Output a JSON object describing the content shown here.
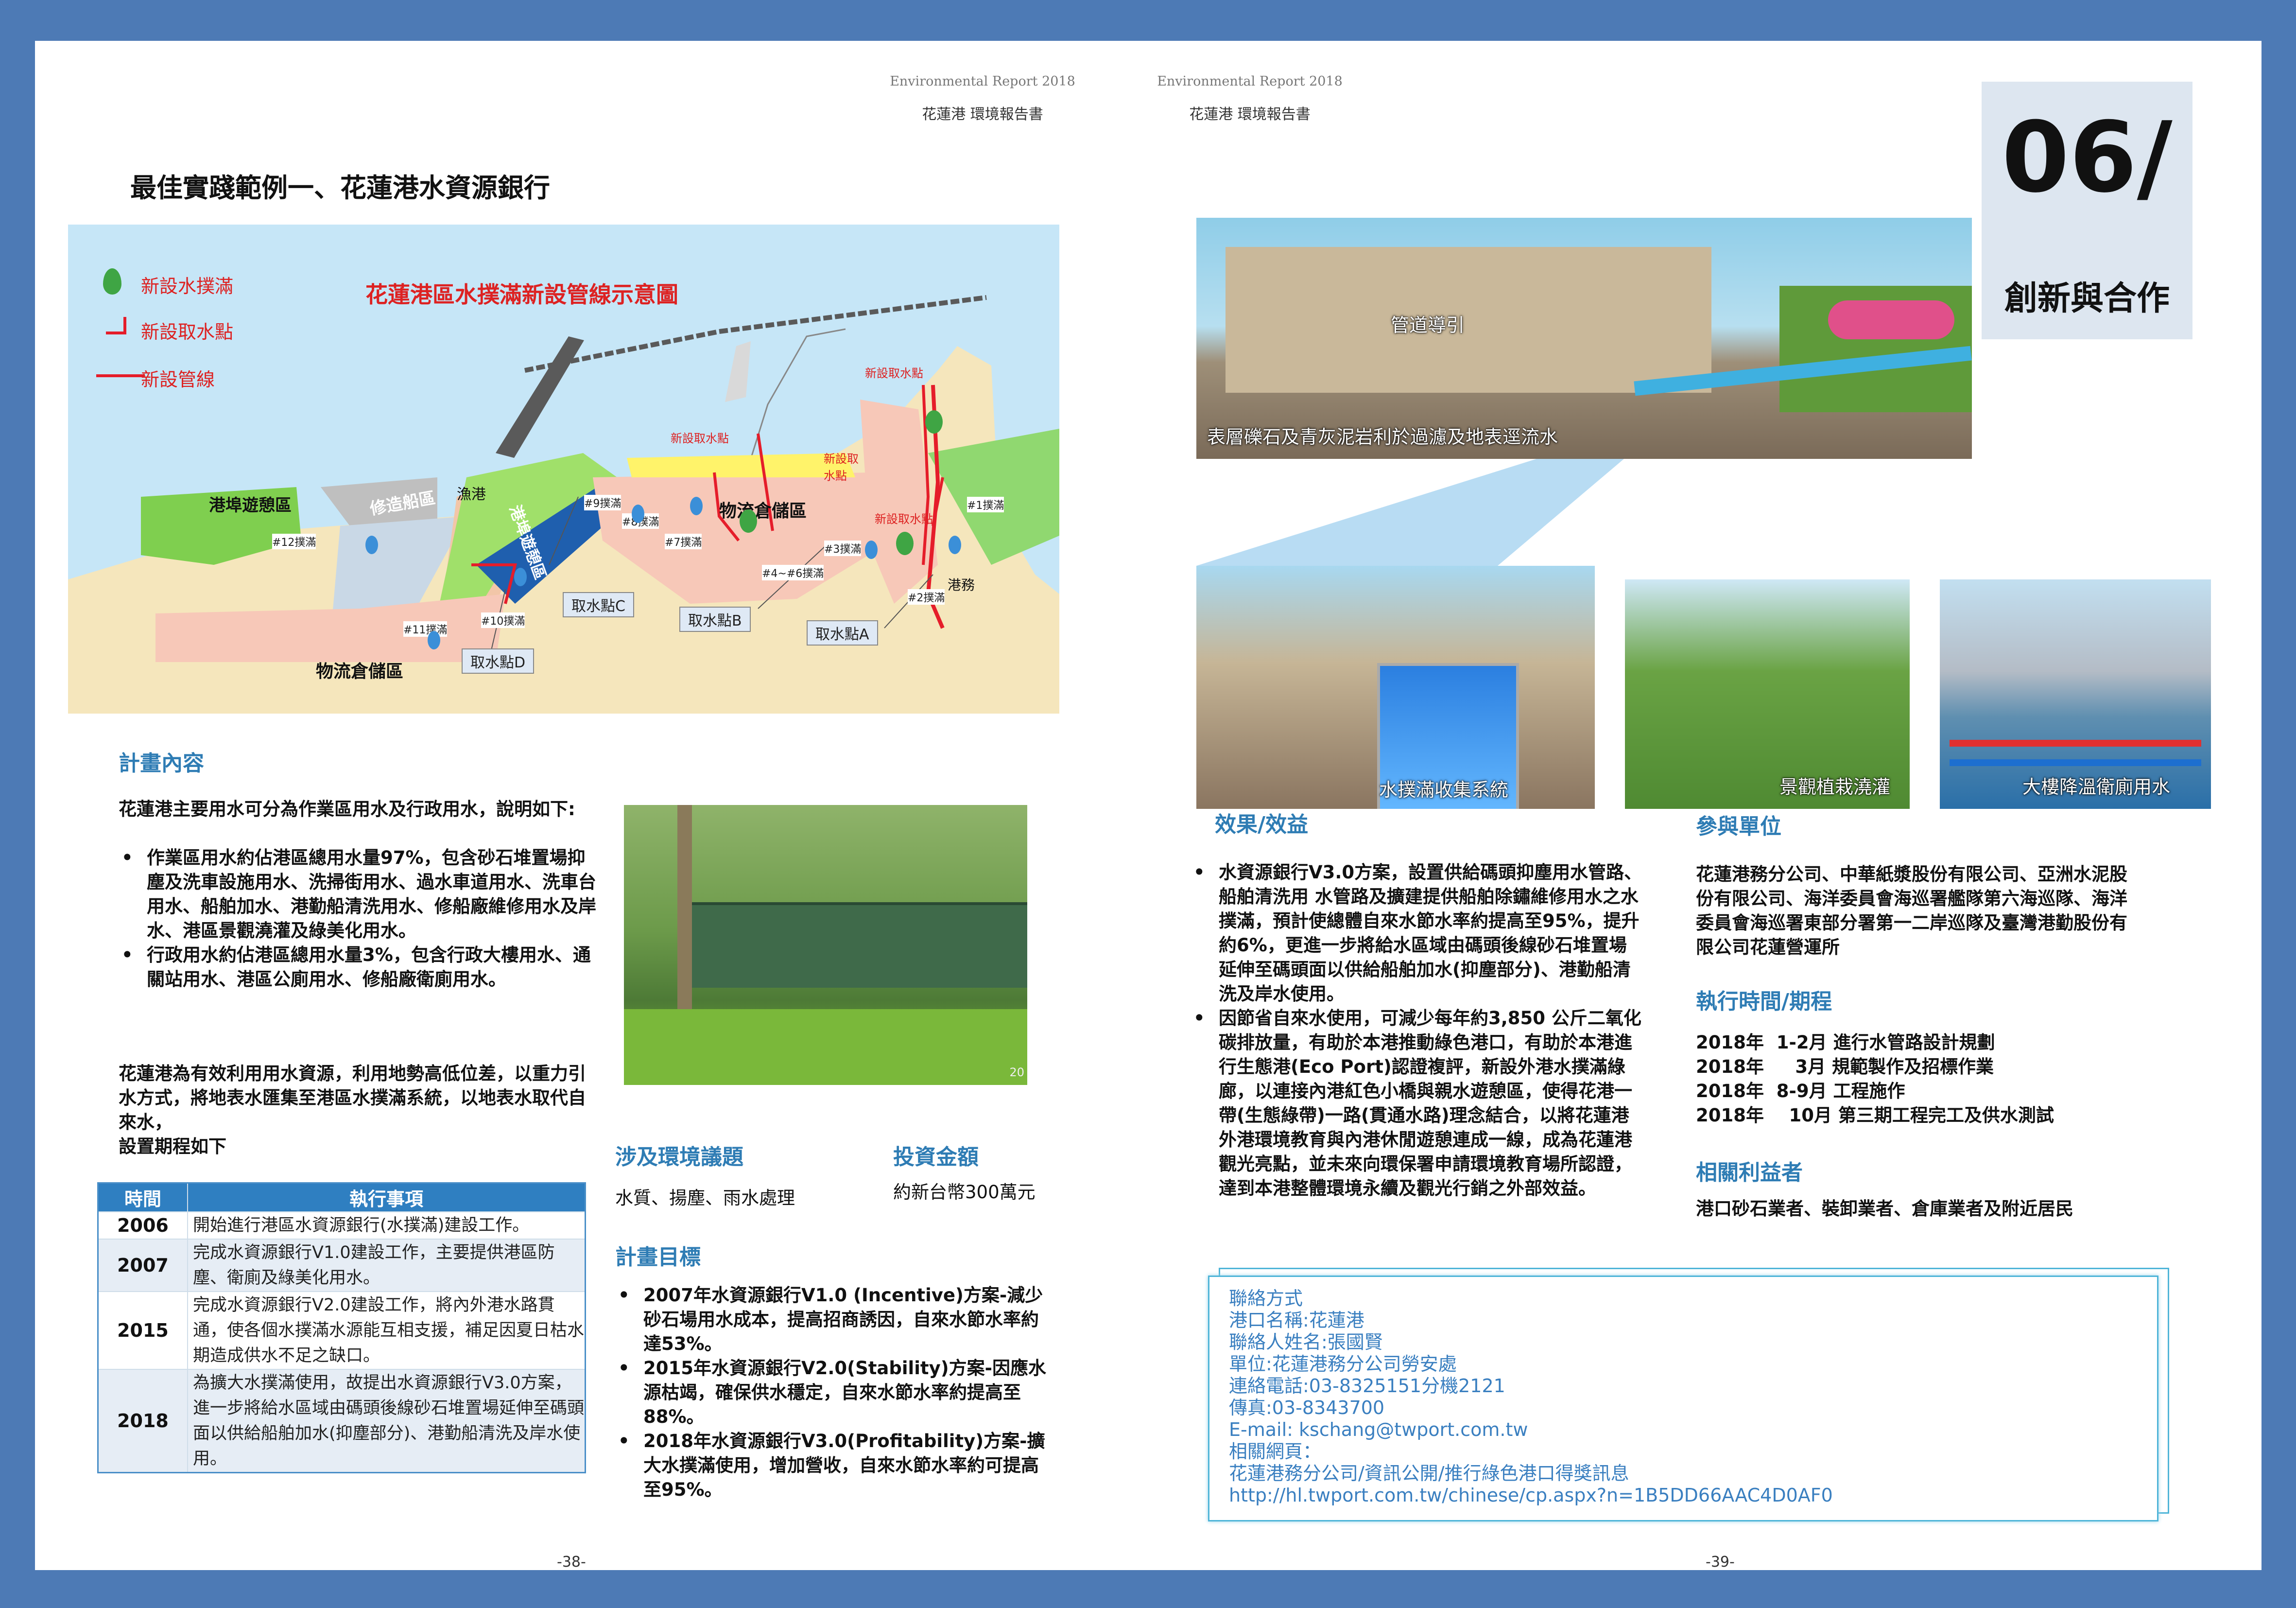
{
  "left_page": {
    "header_en": "Environmental Report 2018",
    "header_zh": "花蓮港 環境報告書",
    "title": "最佳實踐範例一、花蓮港水資源銀行",
    "page_number": "-38-",
    "map": {
      "title": "花蓮港區水撲滿新設管線示意圖",
      "legend": [
        "新設水撲滿",
        "新設取水點",
        "新設管線"
      ],
      "zones": [
        "港埠遊憩區",
        "修造船區",
        "漁港",
        "港埠遊憩區",
        "物流倉儲區",
        "物流倉儲區",
        "港務"
      ],
      "intakes_small": [
        "新設取水點",
        "新設取水點",
        "新設取水點",
        "新設取水點"
      ],
      "boxes": [
        "取水點C",
        "取水點B",
        "取水點A",
        "取水點D"
      ],
      "tanks": [
        "#12撲滿",
        "#11撲滿",
        "#10撲滿",
        "#9撲滿",
        "#8撲滿",
        "#7撲滿",
        "#4~#6撲滿",
        "#3撲滿",
        "#2撲滿",
        "#1撲滿"
      ]
    },
    "plan_content": {
      "heading": "計畫內容",
      "intro": "花蓮港主要用水可分為作業區用水及行政用水，說明如下:",
      "bullets": [
        "作業區用水約佔港區總用水量97%，包含砂石堆置場抑塵及洗車設施用水、洗掃街用水、過水車道用水、洗車台用水、船舶加水、港勤船清洗用水、修船廠維修用水及岸水、港區景觀澆灌及綠美化用水。",
        "行政用水約佔港區總用水量3%，包含行政大樓用水、通關站用水、港區公廁用水、修船廠衛廁用水。"
      ],
      "para2": "花蓮港為有效利用用水資源，利用地勢高低位差，以重力引水方式，將地表水匯集至港區水撲滿系統，以地表水取代自來水，",
      "para3": "設置期程如下"
    },
    "schedule_table": {
      "headers": [
        "時間",
        "執行事項"
      ],
      "rows": [
        {
          "year": "2006",
          "item": "開始進行港區水資源銀行(水撲滿)建設工作。"
        },
        {
          "year": "2007",
          "item": "完成水資源銀行V1.0建設工作，主要提供港區防塵、衛廁及綠美化用水。"
        },
        {
          "year": "2015",
          "item": "完成水資源銀行V2.0建設工作，將內外港水路貫通，使各個水撲滿水源能互相支援，補足因夏日枯水期造成供水不足之缺口。"
        },
        {
          "year": "2018",
          "item": "為擴大水撲滿使用，故提出水資源銀行V3.0方案，進一步將給水區域由碼頭後線砂石堆置場延伸至碼頭面以供給船舶加水(抑塵部分)、港勤船清洗及岸水使用。"
        }
      ]
    },
    "env_issues": {
      "heading": "涉及環境議題",
      "text": "水質、揚塵、雨水處理"
    },
    "investment": {
      "heading": "投資金額",
      "text": "約新台幣300萬元"
    },
    "plan_goals": {
      "heading": "計畫目標",
      "bullets": [
        "2007年水資源銀行V1.0 (Incentive)方案-減少砂石場用水成本，提高招商誘因，自來水節水率約達53%。",
        "2015年水資源銀行V2.0(Stability)方案-因應水源枯竭，確保供水穩定，自來水節水率約提高至88%。",
        "2018年水資源銀行V3.0(Profitability)方案-擴大水撲滿使用，增加營收，自來水節水率約可提高至95%。"
      ]
    },
    "photo_number": "20"
  },
  "right_page": {
    "header_en": "Environmental Report 2018",
    "header_zh": "花蓮港 環境報告書",
    "chapter_number": "06/",
    "chapter_title": "創新與合作",
    "page_number": "-39-",
    "photo_captions": {
      "pipe": "管道導引",
      "rock": "表層礫石及青灰泥岩利於過濾及地表逕流水",
      "tank": "水撲滿收集系統",
      "garden": "景觀植栽澆灌",
      "building": "大樓降溫衛廁用水"
    },
    "effects": {
      "heading": "效果/效益",
      "bullets": [
        "水資源銀行V3.0方案，設置供給碼頭抑塵用水管路、船舶清洗用 水管路及擴建提供船舶除鏽維修用水之水撲滿，預計使總體自來水節水率約提高至95%，提升約6%，更進一步將給水區域由碼頭後線砂石堆置場延伸至碼頭面以供給船舶加水(抑塵部分)、港勤船清洗及岸水使用。",
        "因節省自來水使用，可減少每年約3,850 公斤二氧化碳排放量，有助於本港推動綠色港口，有助於本港進行生態港(Eco Port)認證複評，新設外港水撲滿綠廊，以連接內港紅色小橋與親水遊憩區，使得花港一帶(生態綠帶)一路(貫通水路)理念結合，以將花蓮港外港環境教育與內港休閒遊憩連成一線，成為花蓮港觀光亮點，並未來向環保署申請環境教育場所認證，達到本港整體環境永續及觀光行銷之外部效益。"
      ]
    },
    "participants": {
      "heading": "參與單位",
      "text": "花蓮港務分公司、中華紙漿股份有限公司、亞洲水泥股份有限公司、海洋委員會海巡署艦隊第六海巡隊、海洋委員會海巡署東部分署第一二岸巡隊及臺灣港勤股份有限公司花蓮營運所"
    },
    "timeline": {
      "heading": "執行時間/期程",
      "lines": [
        "2018年  1-2月 進行水管路設計規劃",
        "2018年     3月 規範製作及招標作業",
        "2018年  8-9月 工程施作",
        "2018年    10月 第三期工程完工及供水測試"
      ]
    },
    "stakeholders": {
      "heading": "相關利益者",
      "text": "港口砂石業者、裝卸業者、倉庫業者及附近居民"
    },
    "contact": {
      "lines": [
        "聯絡方式",
        "港口名稱:花蓮港",
        "聯絡人姓名:張國賢",
        "單位:花蓮港務分公司勞安處",
        "連絡電話:03-8325151分機2121",
        "傳真:03-8343700",
        "E-mail: kschang@twport.com.tw",
        "相關網頁：",
        "花蓮港務分公司/資訊公開/推行綠色港口得獎訊息",
        "http://hl.twport.com.tw/chinese/cp.aspx?n=1B5DD66AAC4D0AF0"
      ]
    }
  }
}
